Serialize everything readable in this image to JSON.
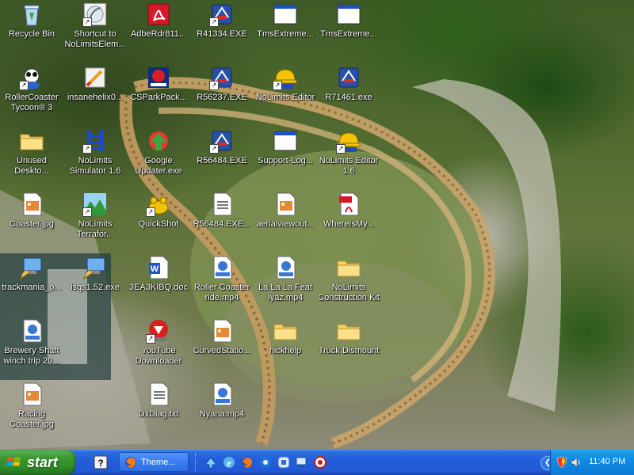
{
  "desktop": {
    "icons": [
      {
        "label": "Recycle Bin",
        "icon": "recycle-bin-icon",
        "shortcut": false
      },
      {
        "label": "Shortcut to NoLimitsElem...",
        "icon": "shortcut-window-icon",
        "shortcut": true
      },
      {
        "label": "AdbeRdr811...",
        "icon": "adobe-reader-icon",
        "shortcut": false
      },
      {
        "label": "R41334.EXE",
        "icon": "exe-app-icon",
        "shortcut": true
      },
      {
        "label": "TmsExtreme...",
        "icon": "window-app-icon",
        "shortcut": false
      },
      {
        "label": "TmsExtreme...",
        "icon": "window-app-icon",
        "shortcut": false
      },
      {
        "label": "RollerCoaster Tycoon® 3",
        "icon": "rct3-icon",
        "shortcut": true
      },
      {
        "label": "insanehelix0...",
        "icon": "paint-brush-icon",
        "shortcut": false
      },
      {
        "label": "CSParkPack...",
        "icon": "installer-box-icon",
        "shortcut": false
      },
      {
        "label": "R56237.EXE",
        "icon": "exe-app-icon",
        "shortcut": true
      },
      {
        "label": "NoLimits Editor",
        "icon": "hardhat-editor-icon",
        "shortcut": true
      },
      {
        "label": "R71461.exe",
        "icon": "exe-app-icon",
        "shortcut": false
      },
      {
        "label": "Unused Deskto...",
        "icon": "folder-icon",
        "shortcut": false
      },
      {
        "label": "NoLimits Simulator 1.6",
        "icon": "coaster-track-icon",
        "shortcut": true
      },
      {
        "label": "Google Updater.exe",
        "icon": "google-updater-icon",
        "shortcut": false
      },
      {
        "label": "R56484.EXE",
        "icon": "exe-app-icon",
        "shortcut": true
      },
      {
        "label": "Support-Log...",
        "icon": "window-app-icon",
        "shortcut": false
      },
      {
        "label": "NoLimits Editor 1.6",
        "icon": "hardhat-editor-icon",
        "shortcut": true
      },
      {
        "label": "Coaster.jpg",
        "icon": "image-file-icon",
        "shortcut": false
      },
      {
        "label": "NoLimits Terrafor...",
        "icon": "terrain-icon",
        "shortcut": true
      },
      {
        "label": "QuickShot",
        "icon": "frog-icon",
        "shortcut": true
      },
      {
        "label": "R56484.EXE...",
        "icon": "text-file-icon",
        "shortcut": false
      },
      {
        "label": "aerialviewout...",
        "icon": "image-file-icon",
        "shortcut": false
      },
      {
        "label": "WhereIsMy...",
        "icon": "pdf-file-icon",
        "shortcut": false
      },
      {
        "label": "trackmania_o...",
        "icon": "setup-computer-icon",
        "shortcut": false
      },
      {
        "label": "isqs1.52.exe",
        "icon": "setup-computer-icon",
        "shortcut": false
      },
      {
        "label": "3EA3KIBQ.doc",
        "icon": "word-doc-icon",
        "shortcut": false
      },
      {
        "label": "Roller Coaster ride.mp4",
        "icon": "mpc-video-icon",
        "shortcut": false
      },
      {
        "label": "La La La Feat Iyaz.mp4",
        "icon": "mpc-video-icon",
        "shortcut": false
      },
      {
        "label": "NoLimits Construction Kit",
        "icon": "folder-icon",
        "shortcut": false
      },
      {
        "label": "Brewery Shaft winch trip 20...",
        "icon": "mpc-video-icon",
        "shortcut": false
      },
      {
        "label": "YouTube Downloader",
        "icon": "youtube-downloader-icon",
        "shortcut": true
      },
      {
        "label": "CurvedStatio...",
        "icon": "image-file-icon",
        "shortcut": false
      },
      {
        "label": "nickhelp",
        "icon": "folder-icon",
        "shortcut": false
      },
      {
        "label": "Truck Dismount",
        "icon": "folder-icon",
        "shortcut": false
      },
      {
        "label": "Racing Coaster.jpg",
        "icon": "image-file-icon",
        "shortcut": false
      },
      {
        "label": "DxDiag.txt",
        "icon": "text-file-icon",
        "shortcut": false
      },
      {
        "label": "Nyana.mp4",
        "icon": "mpc-video-icon",
        "shortcut": false
      }
    ]
  },
  "taskbar": {
    "start_label": "start",
    "quick_launch": [
      "help-icon"
    ],
    "active_task": {
      "label": "Theme...",
      "icon": "firefox-icon"
    },
    "tray_icons": [
      "arrow-icon",
      "ie-icon",
      "firefox-icon",
      "messenger-icon",
      "skype-icon",
      "network-icon",
      "app-icon"
    ],
    "notification": [
      "shield-icon",
      "volume-icon"
    ],
    "clock": "11:40 PM"
  }
}
